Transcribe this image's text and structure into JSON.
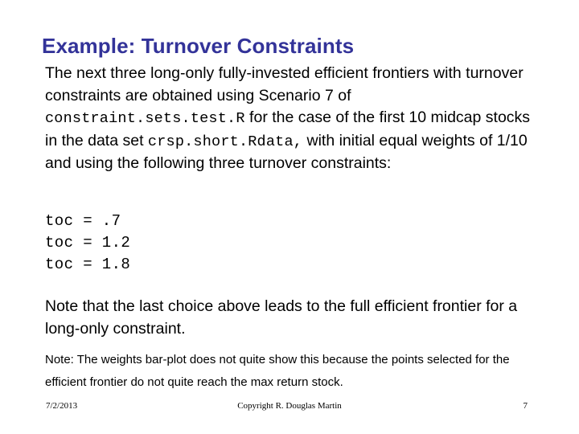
{
  "slide": {
    "title": "Example: Turnover Constraints",
    "body_paragraph": {
      "segment_1": "The next three long-only fully-invested efficient frontiers with turnover constraints are obtained using Scenario 7 of ",
      "code_1": "constraint.sets.test.R",
      "segment_2": " for the case of the first 10 midcap stocks in the data set ",
      "code_2": "crsp.short.Rdata,",
      "segment_3": " with initial equal weights of 1/10 and using the following three turnover constraints:"
    },
    "code_block": {
      "line_1": "toc = .7",
      "line_2": "toc = 1.2",
      "line_3": "toc = 1.8"
    },
    "note_paragraph": "Note that the last choice above leads to the full efficient frontier for a long-only constraint.",
    "small_note": "Note:  The weights bar-plot does not quite show this because the points selected for the efficient frontier do not quite reach the max return stock.",
    "footer": {
      "date": "7/2/2013",
      "copyright": "Copyright R. Douglas Martin",
      "page_number": "7"
    },
    "colors": {
      "title": "#333399",
      "text": "#000000",
      "background": "#ffffff"
    }
  }
}
